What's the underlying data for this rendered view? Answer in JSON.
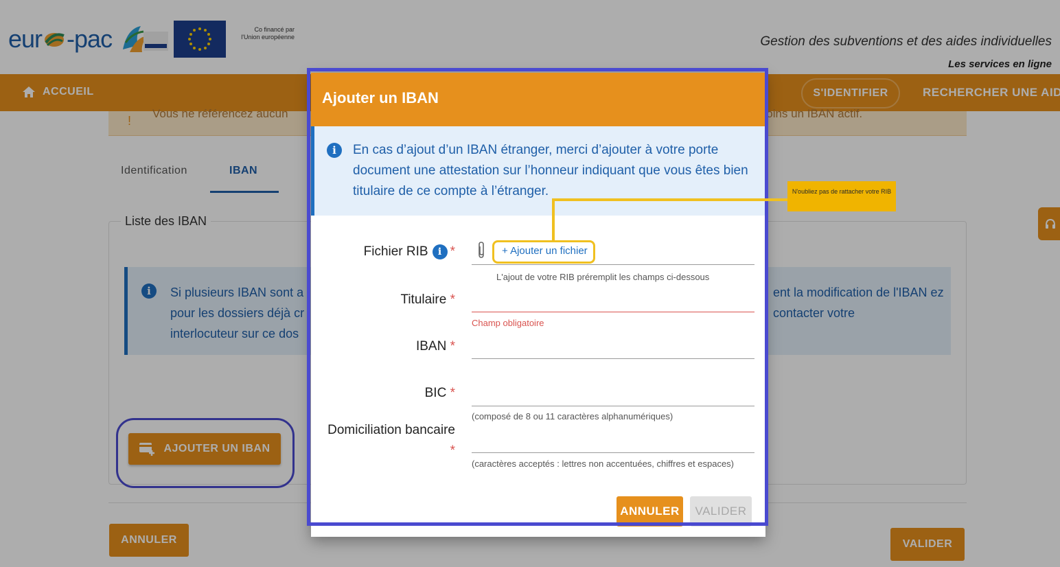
{
  "header": {
    "logo_text_left": "eur",
    "logo_text_right": "-pac",
    "cofinance_line1": "Co financé par",
    "cofinance_line2": "l'Union européenne",
    "tagline": "Gestion des subventions et des aides individuelles",
    "subtagline": "Les services en ligne"
  },
  "navbar": {
    "home_label": "ACCUEIL",
    "login_label": "S'IDENTIFIER",
    "search_label": "RECHERCHER UNE AIDE"
  },
  "background": {
    "warning_text_left": "Vous ne référencez aucun",
    "warning_text_right": "t au moins un IBAN actif.",
    "tabs": [
      "Identification",
      "IBAN"
    ],
    "iban_list_legend": "Liste des IBAN",
    "info_left": "Si plusieurs IBAN sont a pour les dossiers déjà cr interlocuteur sur ce dos",
    "info_right": "ent la modification de l'IBAN ez contacter votre",
    "add_iban_button": "AJOUTER UN IBAN",
    "cancel_button": "ANNULER",
    "validate_button": "VALIDER",
    "side_help_icon": "headset-icon"
  },
  "modal": {
    "title": "Ajouter un IBAN",
    "info_text": "En cas d’ajout d’un IBAN étranger, merci d’ajouter à votre porte document une attestation sur l’honneur indiquant que vous êtes bien titulaire de ce compte à l’étranger.",
    "required_mark": "*",
    "fields": {
      "rib_label": "Fichier RIB",
      "add_file_button": "+ Ajouter un fichier",
      "rib_hint": "L'ajout de votre RIB préremplit les champs ci-dessous",
      "holder_label": "Titulaire",
      "holder_value": "",
      "holder_error": "Champ obligatoire",
      "iban_label": "IBAN",
      "iban_value": "",
      "bic_label": "BIC",
      "bic_value": "",
      "bic_hint": "(composé de 8 ou 11 caractères alphanumériques)",
      "domiciliation_label": "Domiciliation bancaire",
      "domiciliation_value": "",
      "domiciliation_hint": "(caractères acceptés : lettres non accentuées, chiffres et espaces)"
    },
    "cancel_button": "ANNULER",
    "validate_button": "VALIDER"
  },
  "annotation": {
    "callout_text": "N'oubliez pas de rattacher votre RIB",
    "highlight_color": "#4a4ad0",
    "callout_color": "#f0c020"
  },
  "colors": {
    "accent": "#e6901d",
    "primary_blue": "#1f5fa8",
    "error": "#d9534f"
  }
}
